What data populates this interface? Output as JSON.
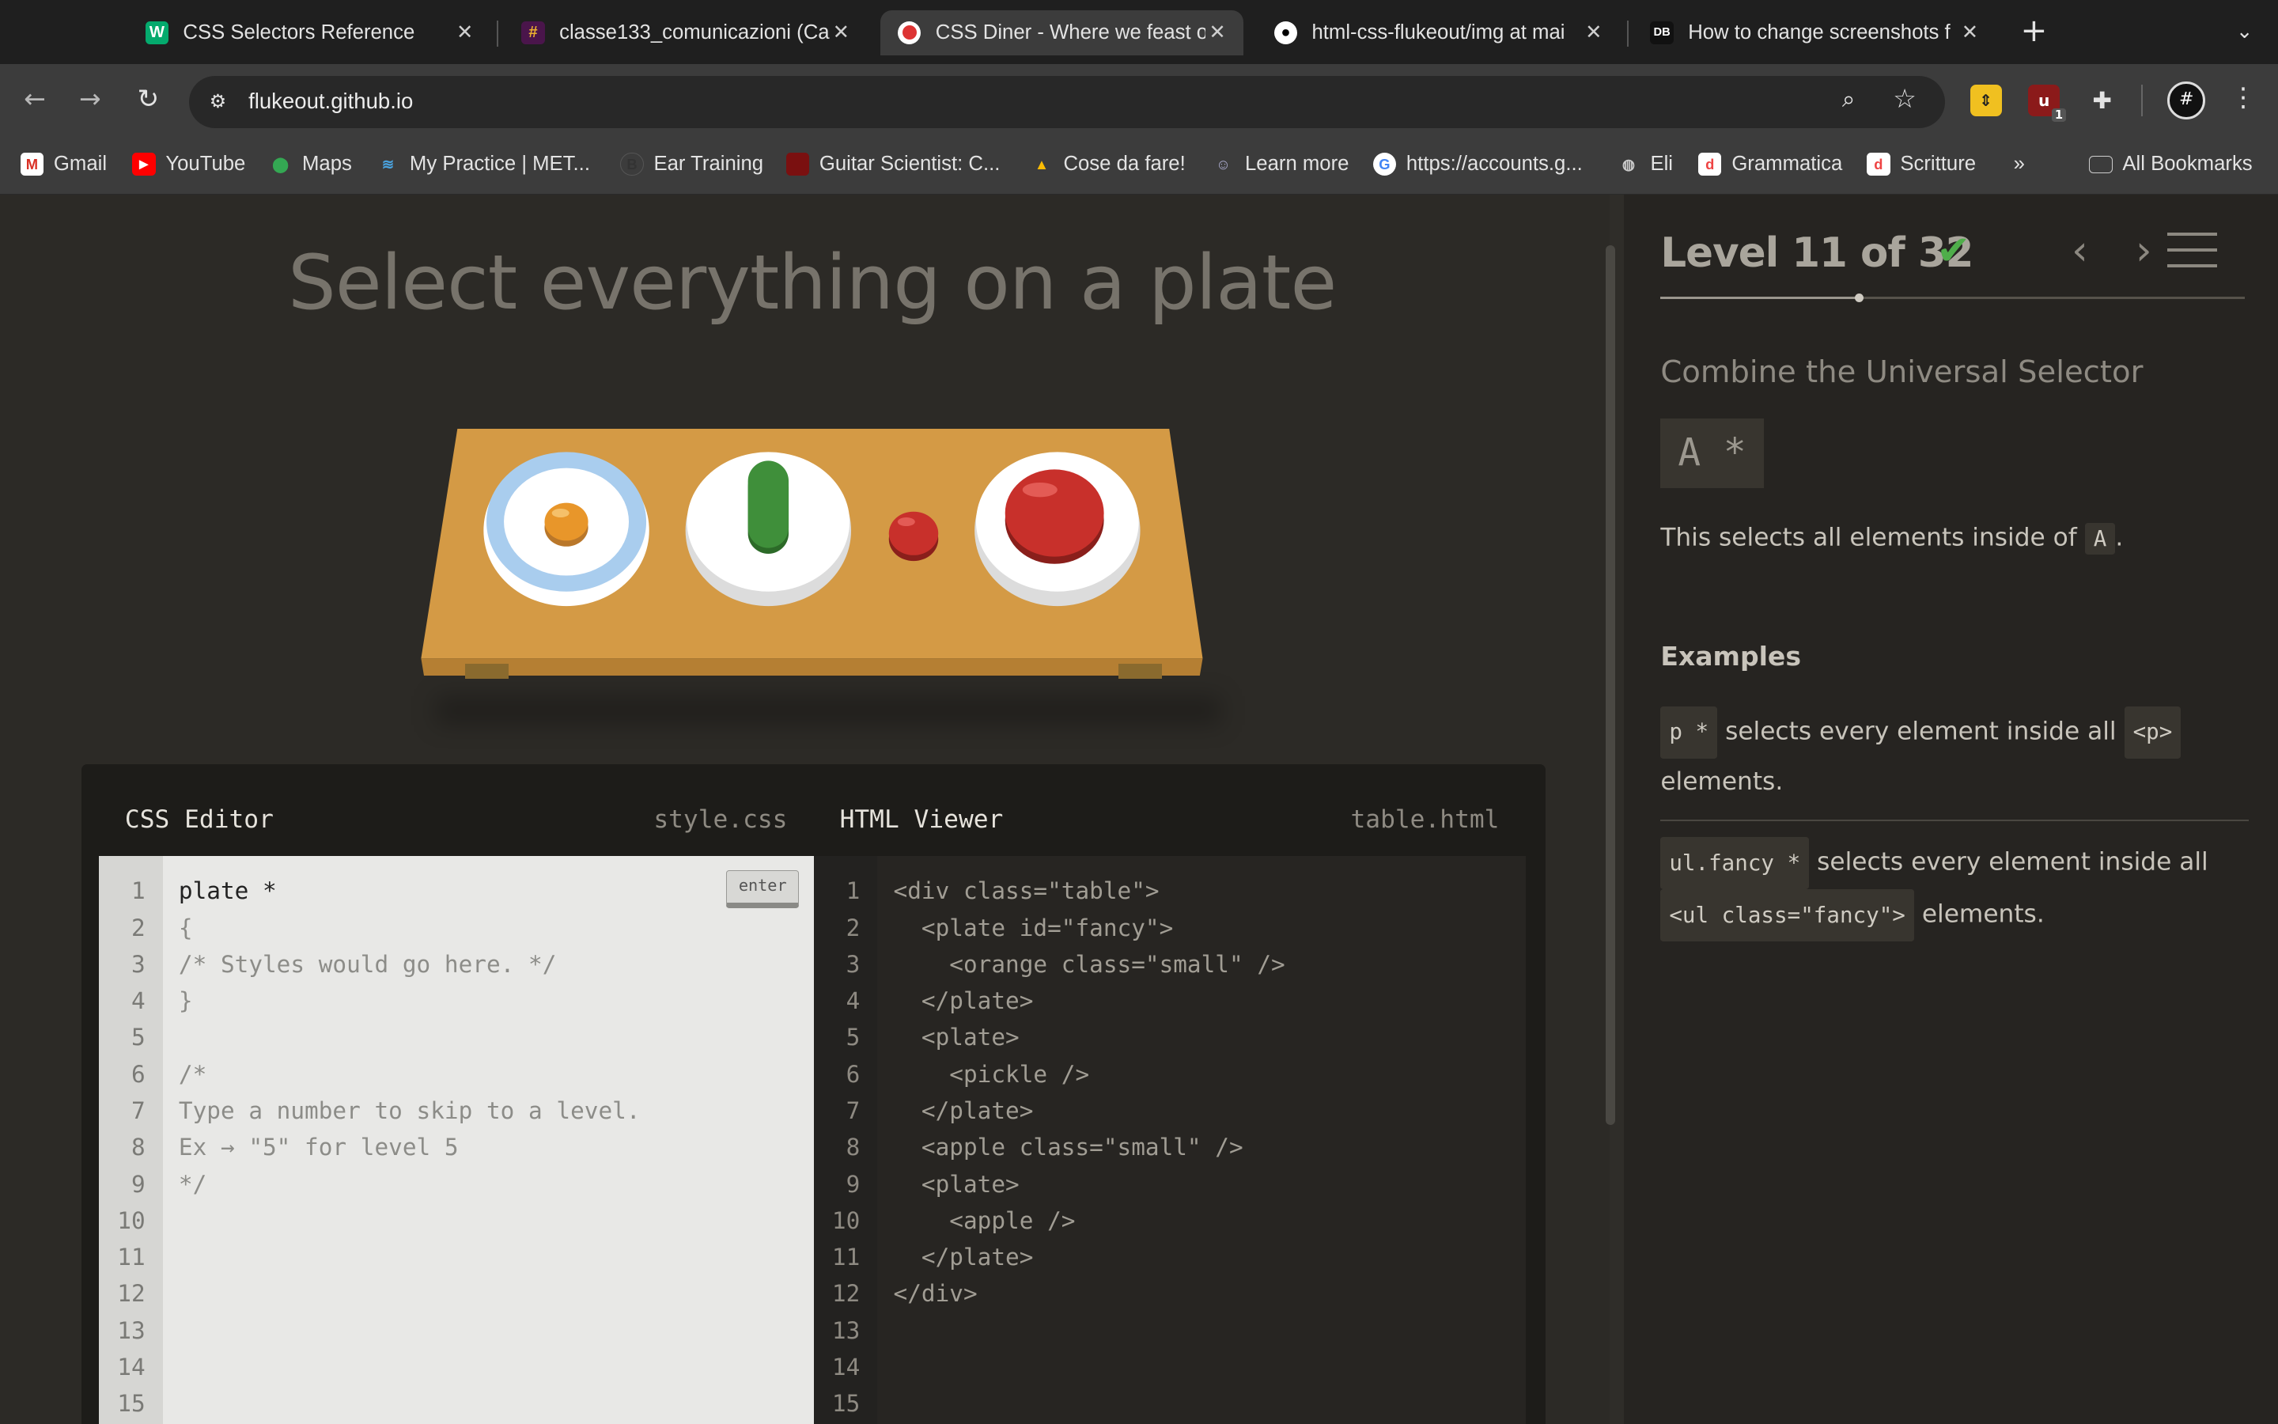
{
  "browser": {
    "tabs": [
      {
        "title": "CSS Selectors Reference",
        "icon": "w3schools-icon",
        "active": false
      },
      {
        "title": "classe133_comunicazioni (Ca",
        "icon": "slack-icon",
        "active": false
      },
      {
        "title": "CSS Diner - Where we feast o",
        "icon": "css-diner-icon",
        "active": true
      },
      {
        "title": "html-css-flukeout/img at mai",
        "icon": "github-icon",
        "active": false
      },
      {
        "title": "How to change screenshots f",
        "icon": "idb-icon",
        "active": false
      }
    ],
    "url": "flukeout.github.io",
    "bookmarks": [
      {
        "label": "Gmail"
      },
      {
        "label": "YouTube"
      },
      {
        "label": "Maps"
      },
      {
        "label": "My Practice | MET..."
      },
      {
        "label": "Ear Training"
      },
      {
        "label": "Guitar Scientist: C..."
      },
      {
        "label": "Cose da fare!"
      },
      {
        "label": "Learn more"
      },
      {
        "label": "https://accounts.g..."
      },
      {
        "label": "Eli"
      },
      {
        "label": "Grammatica"
      },
      {
        "label": "Scritture"
      },
      {
        "label": "All Bookmarks"
      }
    ],
    "extension_badge": "1"
  },
  "game": {
    "order": "Select everything on a plate",
    "editor": {
      "css_title": "CSS Editor",
      "css_file": "style.css",
      "html_title": "HTML Viewer",
      "html_file": "table.html",
      "enter_label": "enter",
      "css_lines": [
        "plate *",
        "{",
        "/* Styles would go here. */",
        "}",
        "",
        "/*",
        "Type a number to skip to a level.",
        "Ex → \"5\" for level 5",
        "*/",
        "",
        "",
        "",
        "",
        "",
        ""
      ],
      "html_lines": [
        "<div class=\"table\">",
        "  <plate id=\"fancy\">",
        "    <orange class=\"small\" />",
        "  </plate>",
        "  <plate>",
        "    <pickle />",
        "  </plate>",
        "  <apple class=\"small\" />",
        "  <plate>",
        "    <apple />",
        "  </plate>",
        "</div>",
        "",
        "",
        ""
      ]
    }
  },
  "sidebar": {
    "level_text": "Level 11 of 32",
    "completed": true,
    "progress": 0.34,
    "selector_name": "Combine the Universal Selector",
    "syntax": "A  *",
    "hint_before": "This selects all elements inside of",
    "hint_code": "A",
    "hint_after": ".",
    "examples_title": "Examples",
    "examples": [
      {
        "code": "p  *",
        "text": "selects every element inside all",
        "code2": "<p>",
        "text2": "elements."
      },
      {
        "code": "ul.fancy  *",
        "text": "selects every element inside all",
        "code2": "<ul class=\"fancy\">",
        "text2": "elements."
      }
    ]
  },
  "colors": {
    "check": "#4fae4a",
    "table": "#d49a45",
    "apple": "#c8302b",
    "pickle": "#3f8f3a",
    "orange": "#e8962a"
  }
}
